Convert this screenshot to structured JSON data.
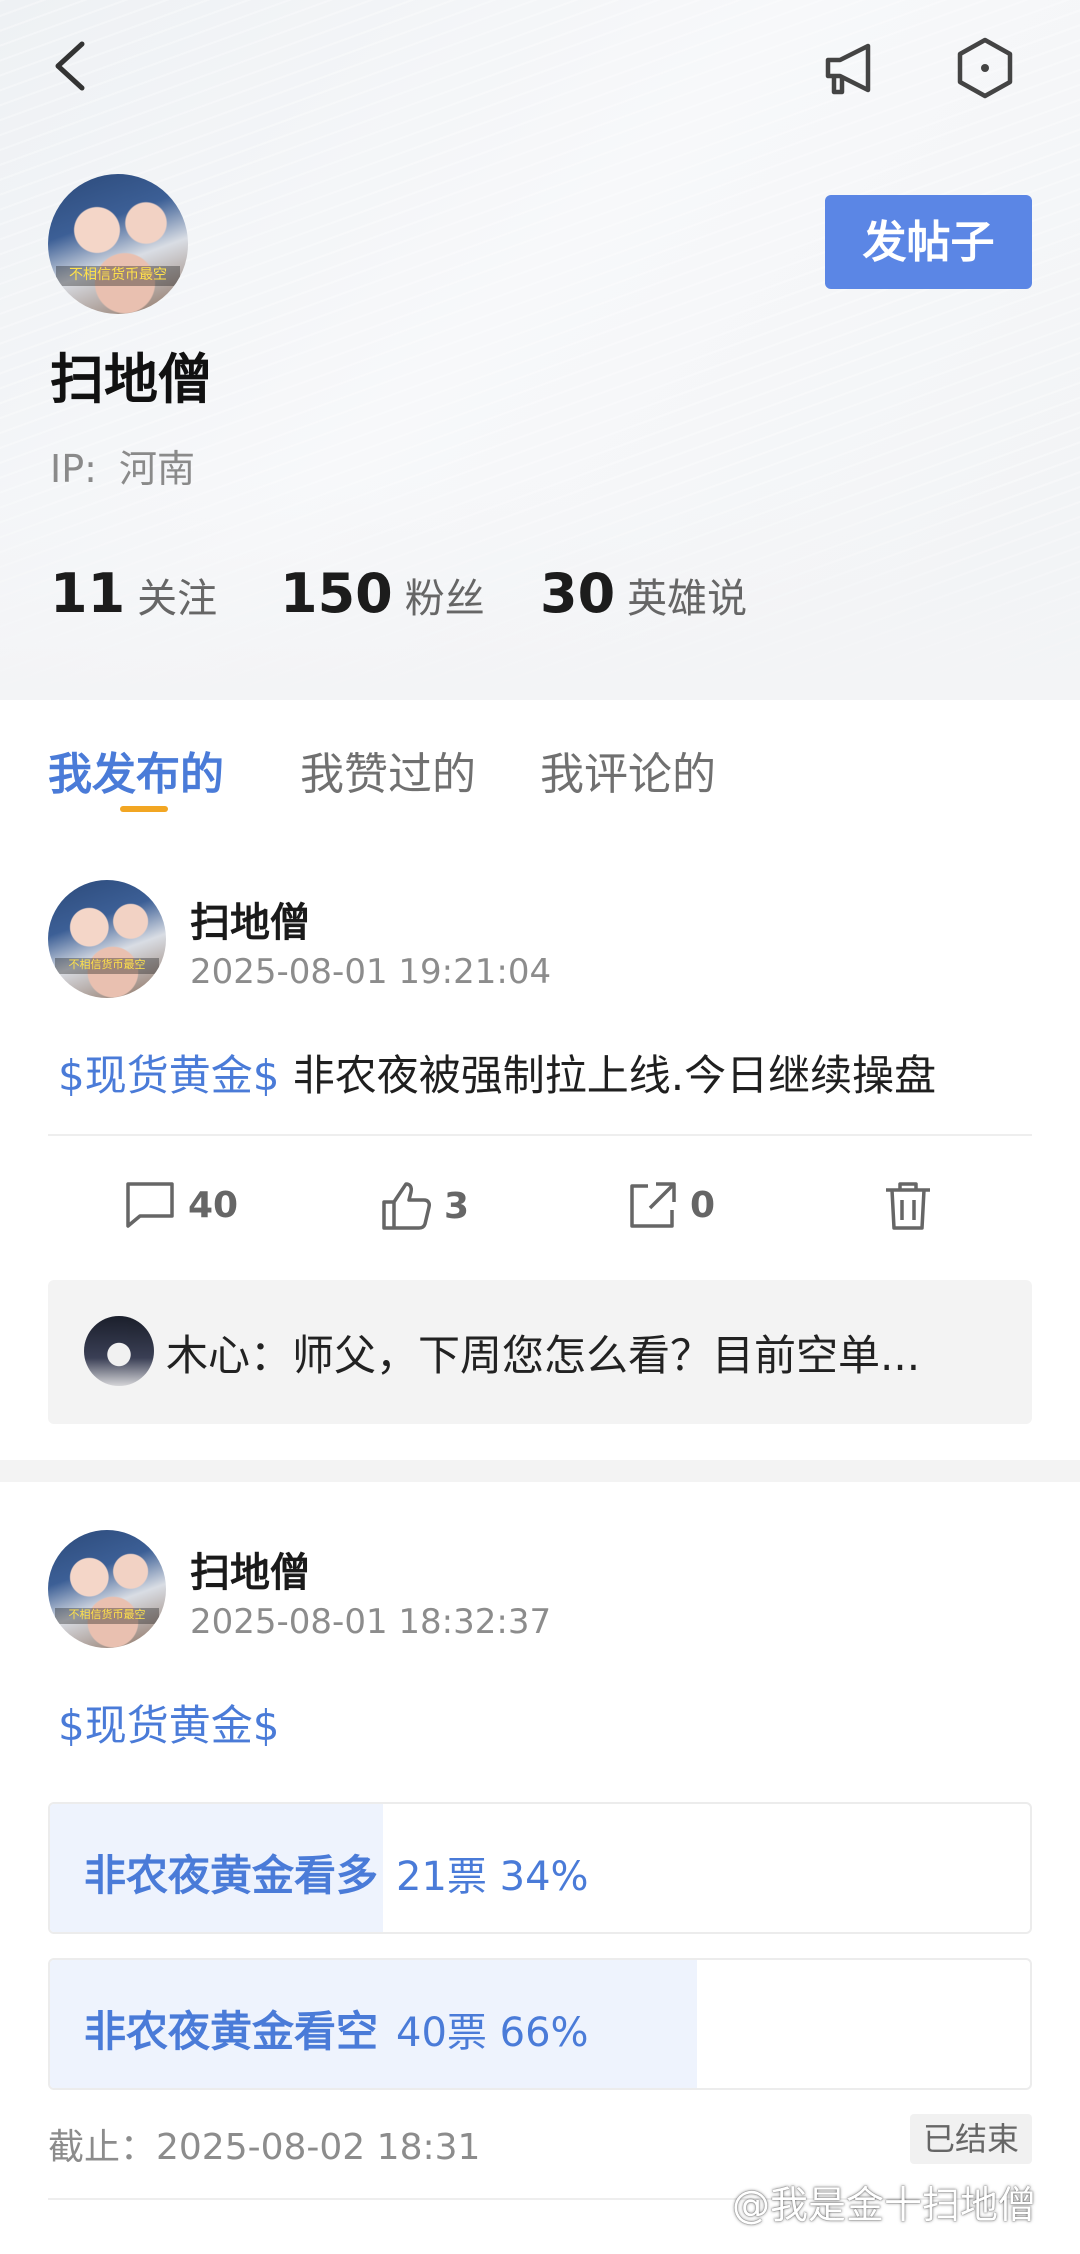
{
  "header": {
    "back_icon": "chevron-left-icon",
    "announce_icon": "megaphone-icon",
    "settings_icon": "hexagon-settings-icon",
    "post_button_label": "发帖子",
    "accent_color": "#5b86e5"
  },
  "profile": {
    "avatar_caption": "不相信货币最空",
    "username": "扫地僧",
    "ip_label": "IP:",
    "ip_value": "河南",
    "stats": [
      {
        "value": "11",
        "label": "关注"
      },
      {
        "value": "150",
        "label": "粉丝"
      },
      {
        "value": "30",
        "label": "英雄说"
      }
    ]
  },
  "tabs": [
    {
      "label": "我发布的",
      "active": true
    },
    {
      "label": "我赞过的",
      "active": false
    },
    {
      "label": "我评论的",
      "active": false
    }
  ],
  "posts": [
    {
      "author": "扫地僧",
      "time": "2025-08-01 19:21:04",
      "tag": "$现货黄金$",
      "text": " 非农夜被强制拉上线.今日继续操盘",
      "actions": {
        "comments": "40",
        "likes": "3",
        "shares": "0"
      },
      "top_comment": {
        "author": "木心",
        "text": "木心：师父，下周您怎么看？目前空单..."
      }
    },
    {
      "author": "扫地僧",
      "time": "2025-08-01 18:32:37",
      "tag": "$现货黄金$",
      "poll": {
        "options": [
          {
            "label": "非农夜黄金看多",
            "stat": "21票 34%",
            "percent": 34
          },
          {
            "label": "非农夜黄金看空",
            "stat": "40票 66%",
            "percent": 66
          }
        ],
        "deadline": "截止：2025-08-02 18:31",
        "status": "已结束"
      }
    }
  ],
  "watermark": "@我是金十扫地僧"
}
